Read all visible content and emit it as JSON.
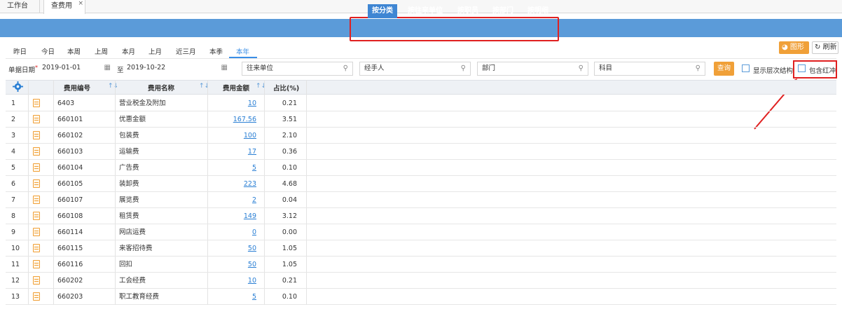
{
  "window_tabs": [
    {
      "label": "工作台"
    },
    {
      "label": "查费用",
      "close": "×"
    }
  ],
  "group_tabs": [
    {
      "label": "按分类",
      "active": true
    },
    {
      "label": "按往来单位"
    },
    {
      "label": "按职员"
    },
    {
      "label": "按部门"
    },
    {
      "label": "按明细"
    }
  ],
  "period_tabs": [
    "昨日",
    "今日",
    "本周",
    "上周",
    "本月",
    "上月",
    "近三月",
    "本季",
    "本年"
  ],
  "period_active": "本年",
  "toolbar": {
    "chart_label": "图形",
    "refresh_label": "刷新"
  },
  "filters": {
    "date_label": "单据日期",
    "date_required": "*",
    "date_from": "2019-01-01",
    "to_label": "至",
    "date_to": "2019-10-22",
    "partner_placeholder": "往来单位",
    "handler_placeholder": "经手人",
    "dept_placeholder": "部门",
    "subject_placeholder": "科目",
    "query_label": "查询",
    "show_hierarchy_label": "显示层次结构",
    "include_red_label": "包含红冲"
  },
  "table": {
    "headers": {
      "code": "费用编号",
      "name": "费用名称",
      "amount": "费用金额",
      "percent": "占比(%)"
    },
    "rows": [
      {
        "idx": "1",
        "code": "6403",
        "name": "营业税金及附加",
        "amount": "10",
        "percent": "0.21"
      },
      {
        "idx": "2",
        "code": "660101",
        "name": "优惠金额",
        "amount": "167.56",
        "percent": "3.51"
      },
      {
        "idx": "3",
        "code": "660102",
        "name": "包装费",
        "amount": "100",
        "percent": "2.10"
      },
      {
        "idx": "4",
        "code": "660103",
        "name": "运输费",
        "amount": "17",
        "percent": "0.36"
      },
      {
        "idx": "5",
        "code": "660104",
        "name": "广告费",
        "amount": "5",
        "percent": "0.10"
      },
      {
        "idx": "6",
        "code": "660105",
        "name": "装卸费",
        "amount": "223",
        "percent": "4.68"
      },
      {
        "idx": "7",
        "code": "660107",
        "name": "展览费",
        "amount": "2",
        "percent": "0.04"
      },
      {
        "idx": "8",
        "code": "660108",
        "name": "租赁费",
        "amount": "149",
        "percent": "3.12"
      },
      {
        "idx": "9",
        "code": "660114",
        "name": "网店运费",
        "amount": "0",
        "percent": "0.00"
      },
      {
        "idx": "10",
        "code": "660115",
        "name": "来客招待费",
        "amount": "50",
        "percent": "1.05"
      },
      {
        "idx": "11",
        "code": "660116",
        "name": "回扣",
        "amount": "50",
        "percent": "1.05"
      },
      {
        "idx": "12",
        "code": "660202",
        "name": "工会经费",
        "amount": "10",
        "percent": "0.21"
      },
      {
        "idx": "13",
        "code": "660203",
        "name": "职工教育经费",
        "amount": "5",
        "percent": "0.10"
      }
    ]
  },
  "colors": {
    "band": "#5b9bd9",
    "accent": "#3a8ee6",
    "orange": "#f0a038",
    "annotation": "#e02020"
  }
}
